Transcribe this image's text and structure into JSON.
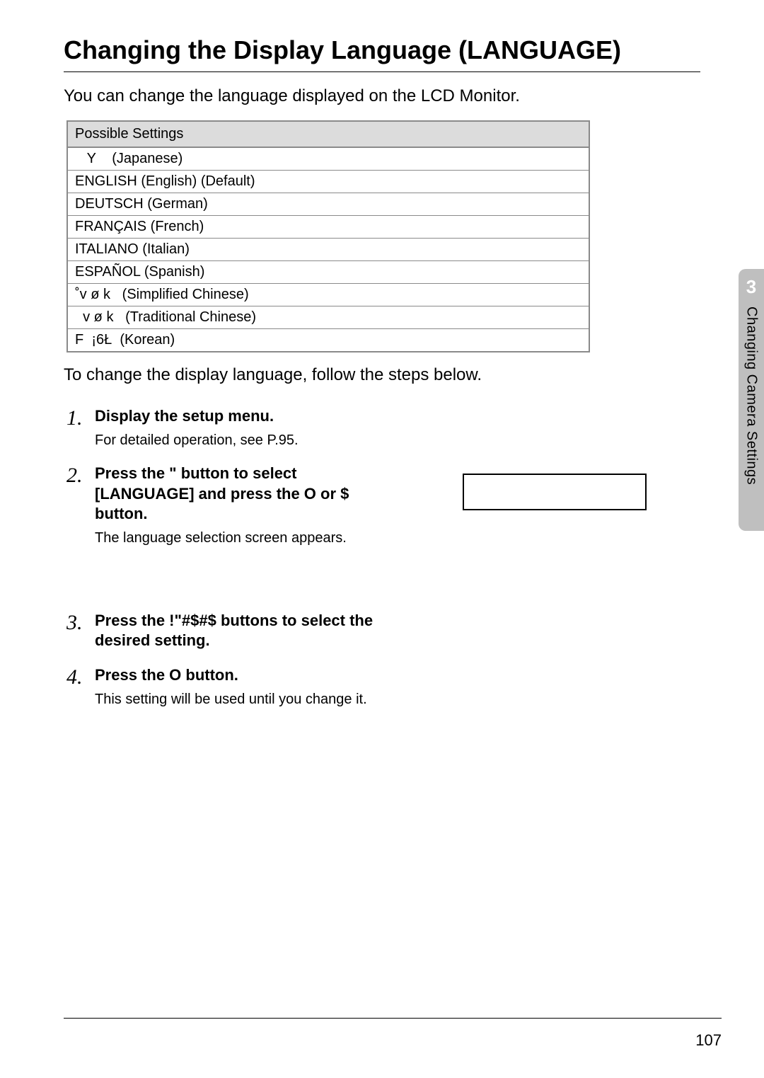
{
  "title": "Changing the Display Language (LANGUAGE)",
  "intro": "You can change the language displayed on the LCD Monitor.",
  "settings_header": "Possible Settings",
  "settings": [
    "   Y    (Japanese)",
    "ENGLISH (English) (Default)",
    "DEUTSCH (German)",
    "FRANÇAIS (French)",
    "ITALIANO (Italian)",
    "ESPAÑOL (Spanish)",
    "˚v ø k   (Simplified Chinese)",
    "  v ø k   (Traditional Chinese)",
    "F  ¡6Ł  (Korean)"
  ],
  "after_table": "To change the display language, follow the steps below.",
  "steps": [
    {
      "num": "1.",
      "title": "Display the setup menu.",
      "desc": "For detailed operation, see P.95."
    },
    {
      "num": "2.",
      "title": "Press the \"  button to select [LANGUAGE] and press the O   or $  button.",
      "desc": "The language selection screen appears.",
      "has_box": true
    },
    {
      "num": "3.",
      "title": "Press the !\"#$#$   buttons to select the desired setting.",
      "desc": ""
    },
    {
      "num": "4.",
      "title": "Press the O    button.",
      "desc": "This setting will be used until you change it."
    }
  ],
  "side_tab": {
    "num": "3",
    "title": "Changing Camera Settings"
  },
  "page_number": "107"
}
